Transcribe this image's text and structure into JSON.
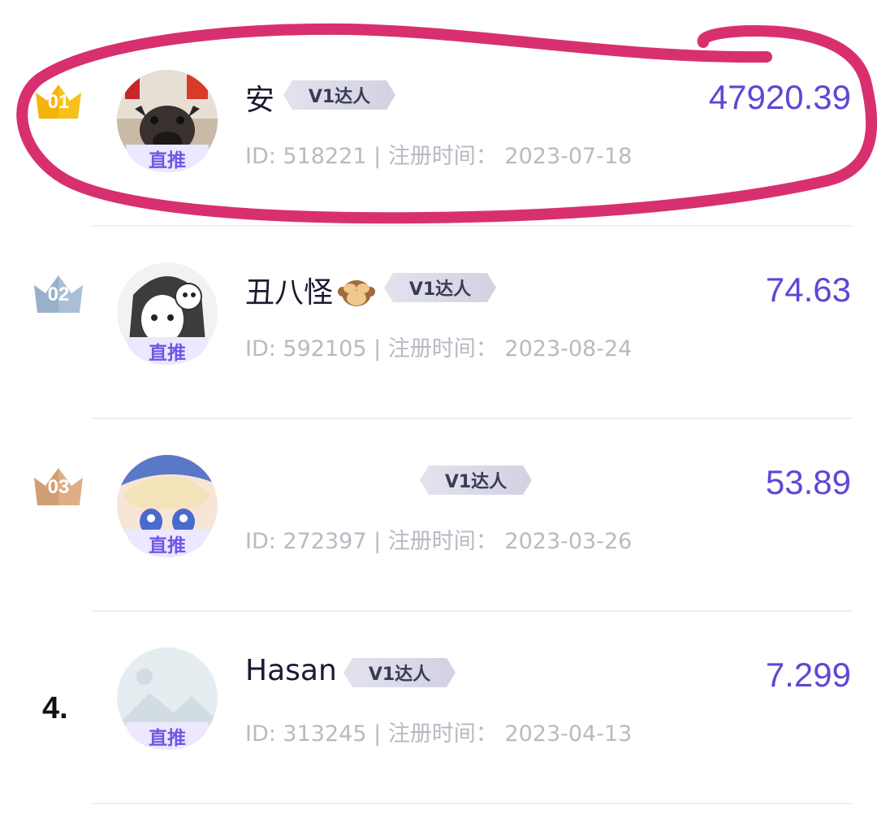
{
  "accent_color": "#5b48d6",
  "highlight_color": "#d8306e",
  "items": [
    {
      "rank": "01",
      "rank_style": "gold-crown",
      "name": "安",
      "emoji": "",
      "badge": "V1达人",
      "tag": "直推",
      "id_label": "ID: 518221",
      "sep": "|",
      "reg_label": "注册时间：",
      "reg_date": "2023-07-18",
      "amount": "47920.39",
      "highlighted": true
    },
    {
      "rank": "02",
      "rank_style": "silver-crown",
      "name": "丑八怪",
      "emoji": "see-no-evil-monkey-icon",
      "badge": "V1达人",
      "tag": "直推",
      "id_label": "ID: 592105",
      "sep": "|",
      "reg_label": "注册时间：",
      "reg_date": "2023-08-24",
      "amount": "74.63"
    },
    {
      "rank": "03",
      "rank_style": "bronze-crown",
      "name": "",
      "emoji": "",
      "badge": "V1达人",
      "tag": "直推",
      "id_label": "ID: 272397",
      "sep": "|",
      "reg_label": "注册时间：",
      "reg_date": "2023-03-26",
      "amount": "53.89"
    },
    {
      "rank": "4.",
      "rank_style": "plain",
      "name": "Hasan",
      "emoji": "",
      "badge": "V1达人",
      "tag": "直推",
      "id_label": "ID: 313245",
      "sep": "|",
      "reg_label": "注册时间：",
      "reg_date": "2023-04-13",
      "amount": "7.299"
    }
  ]
}
